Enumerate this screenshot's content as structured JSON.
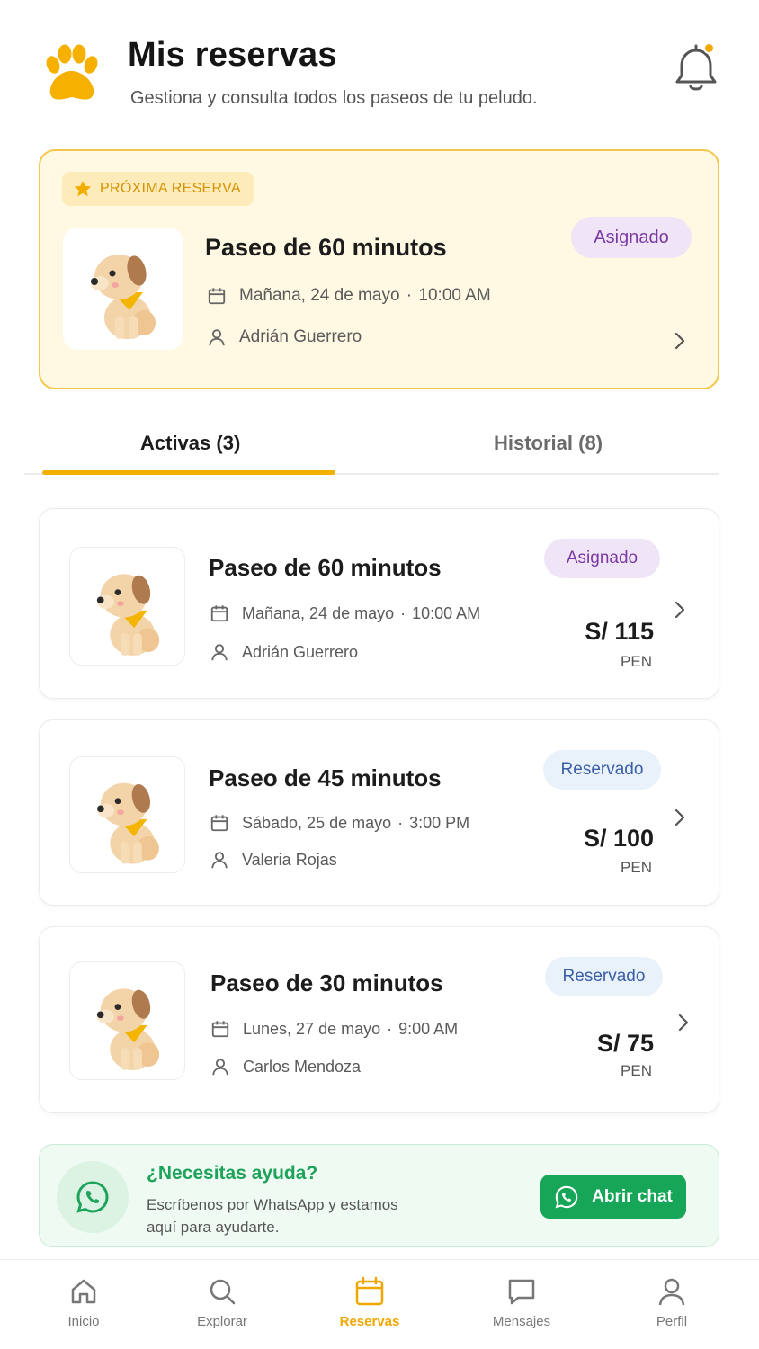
{
  "colors": {
    "accent": "#f2b100",
    "highlight_bg": "#fff8e3",
    "assigned": "#7b3aa3",
    "reserved": "#3a5fa7",
    "whatsapp": "#17a657"
  },
  "header": {
    "title": "Mis reservas",
    "subtitle": "Gestiona y consulta todos los paseos de tu peludo.",
    "logo_icon": "paw-icon",
    "notification_icon": "bell-icon"
  },
  "next_booking": {
    "chip_label": "PRÓXIMA RESERVA",
    "title": "Paseo de 60 minutos",
    "status": "Asignado",
    "date": "Mañana, 24 de mayo",
    "time": "10:00 AM",
    "walker": "Adrián Guerrero"
  },
  "tabs": [
    {
      "label": "Activas (3)",
      "active": true
    },
    {
      "label": "Historial (8)",
      "active": false
    }
  ],
  "bookings": [
    {
      "title": "Paseo de 60 minutos",
      "status": "Asignado",
      "date": "Mañana, 24 de mayo",
      "time": "10:00 AM",
      "walker": "Adrián Guerrero",
      "price": "S/ 115",
      "currency": "PEN"
    },
    {
      "title": "Paseo de 45 minutos",
      "status": "Reservado",
      "date": "Sábado, 25 de mayo",
      "time": "3:00 PM",
      "walker": "Valeria Rojas",
      "price": "S/ 100",
      "currency": "PEN"
    },
    {
      "title": "Paseo de 30 minutos",
      "status": "Reservado",
      "date": "Lunes, 27 de mayo",
      "time": "9:00 AM",
      "walker": "Carlos Mendoza",
      "price": "S/ 75",
      "currency": "PEN"
    }
  ],
  "help": {
    "title": "¿Necesitas ayuda?",
    "text": "Escríbenos por WhatsApp y estamos aquí para ayudarte.",
    "button": "Abrir chat"
  },
  "nav": [
    {
      "label": "Inicio",
      "icon": "home-icon"
    },
    {
      "label": "Explorar",
      "icon": "search-icon"
    },
    {
      "label": "Reservas",
      "icon": "calendar-icon",
      "active": true
    },
    {
      "label": "Mensajes",
      "icon": "message-icon"
    },
    {
      "label": "Perfil",
      "icon": "user-icon"
    }
  ]
}
